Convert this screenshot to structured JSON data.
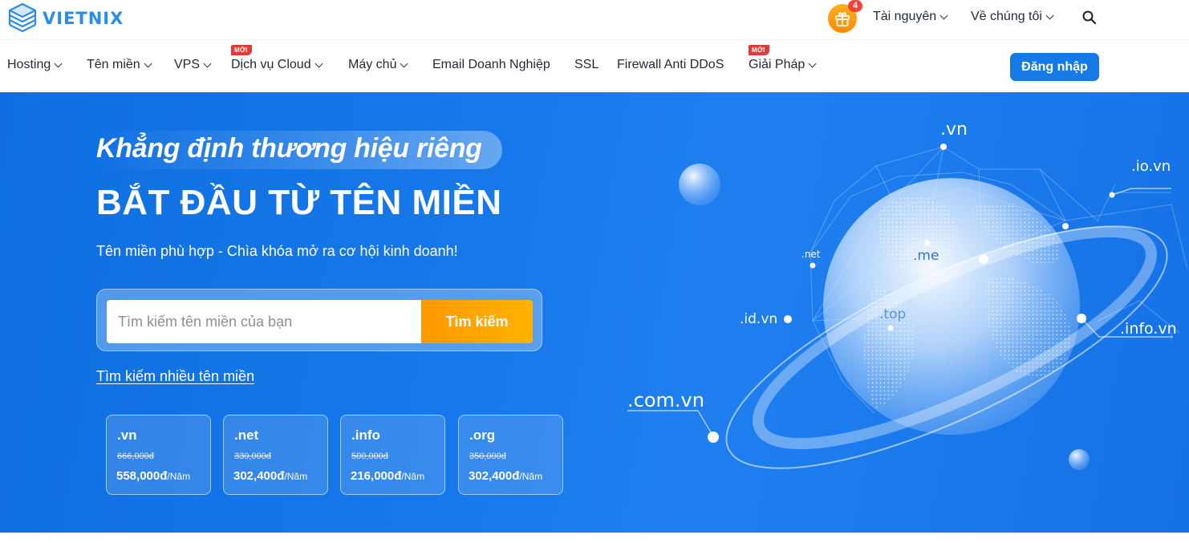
{
  "brand": {
    "name": "VIETNIX"
  },
  "topbar": {
    "gift_count": "4",
    "links": [
      {
        "label": "Tài nguyên"
      },
      {
        "label": "Về chúng tôi"
      }
    ]
  },
  "nav": {
    "items": [
      {
        "label": "Hosting",
        "has_dropdown": true
      },
      {
        "label": "Tên miền",
        "has_dropdown": true
      },
      {
        "label": "VPS",
        "has_dropdown": true
      },
      {
        "label": "Dịch vụ Cloud",
        "has_dropdown": true,
        "tag": "MỚI"
      },
      {
        "label": "Máy chủ",
        "has_dropdown": true
      },
      {
        "label": "Email Doanh Nghiệp",
        "has_dropdown": false
      },
      {
        "label": "SSL",
        "has_dropdown": false
      },
      {
        "label": "Firewall Anti DDoS",
        "has_dropdown": false
      },
      {
        "label": "Giải Pháp",
        "has_dropdown": true,
        "tag": "MỚI"
      }
    ],
    "login_label": "Đăng nhập"
  },
  "hero": {
    "slogan": "Khẳng định thương hiệu riêng",
    "headline": "BẮT ĐẦU TỪ TÊN MIỀN",
    "subline": "Tên miền phù hợp - Chìa khóa mở ra cơ hội kinh doanh!",
    "search": {
      "placeholder": "Tìm kiếm tên miền của bạn",
      "value": "",
      "button_label": "Tìm kiếm"
    },
    "multi_search_link": "Tìm kiếm nhiều tên miền",
    "prices": [
      {
        "ext": ".vn",
        "old": "666,000đ",
        "new": "558,000đ",
        "unit": "/Năm"
      },
      {
        "ext": ".net",
        "old": "330,000đ",
        "new": "302,400đ",
        "unit": "/Năm"
      },
      {
        "ext": ".info",
        "old": "500,000đ",
        "new": "216,000đ",
        "unit": "/Năm"
      },
      {
        "ext": ".org",
        "old": "350,000đ",
        "new": "302,400đ",
        "unit": "/Năm"
      }
    ],
    "globe_tlds": {
      "vn": ".vn",
      "io_vn": ".io.vn",
      "net": ".net",
      "me": ".me",
      "id_vn": ".id.vn",
      "top": ".top",
      "info_vn": ".info.vn",
      "com_vn": ".com.vn"
    }
  },
  "colors": {
    "brand_blue": "#2a8de8",
    "login_button": "#1579e6",
    "hero_blue": "#1678ea",
    "search_button": "#ff9800",
    "new_tag": "#e53935",
    "gift": "#ff9800"
  },
  "icons": {
    "logo": "stacked-cube-logo-icon",
    "gift": "gift-icon",
    "search": "search-icon",
    "chevron": "chevron-down-icon"
  }
}
